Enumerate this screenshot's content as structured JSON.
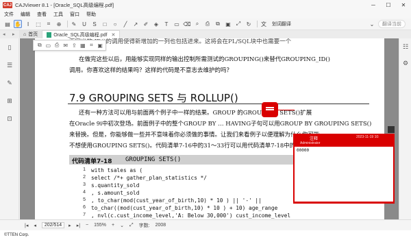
{
  "window": {
    "app_logo": "CAJ",
    "title": "CAJViewer 8.1 - [Oracle_SQL高级编程.pdf]",
    "minimize": "─",
    "maximize": "☐",
    "close": "✕"
  },
  "menu": [
    "文件",
    "编辑",
    "查看",
    "工具",
    "窗口",
    "帮助"
  ],
  "toolbar": {
    "translate_label": "划词翻译",
    "translate_current": "翻译当前"
  },
  "tabs": {
    "home": "首页",
    "doc": "Oracle_SQL高级编程.pdf",
    "doc_close": "✕"
  },
  "page": {
    "line1": "面定义的 ID()的调用使得新增加的一列也包括进来。这将会在PL/SQL块中也需要一个",
    "line2": "在做完这些以后，用能够实现同样的输出控制所需测试的GROUPING()来替代GROUPING_ID()",
    "line3": "调用。你喜欢这样的结果吗？这样的代码是不意志去维护的吗？",
    "heading": "7.9  GROUPING SETS 与 ROLLUP()",
    "para1": "还有一种方法可以用与前面两个例子中一样的结果。GROUP  的GROUPING SETS()扩展",
    "para2": "在Oracle 9i中初次登场。前面例子中的整个GROUP BY … HAVING子句可以用GROUP BY GROUPING SETS()",
    "para3": "来替换。但是，你能够做一些并不意味着你必须做的事情。让我们来看例子以便理解为什么你可能",
    "para4": "不想使用GROUPING SETS()。代码清单7-16中的31～33行可以用代码清单7-18中的",
    "listing_label": "代码清单7-18",
    "listing_title": "GROUPING SETS()",
    "code": [
      {
        "num": "1",
        "text": "with tsales as ("
      },
      {
        "num": "2",
        "text": "select /*+ gather_plan_statistics */"
      },
      {
        "num": "3",
        "text": "   s.quantity_sold"
      },
      {
        "num": "4",
        "text": "   , s.amount_sold"
      },
      {
        "num": "5",
        "text": "   , to_char(mod(cust_year_of_birth,10) * 10 ) || '-' ||"
      },
      {
        "num": "6",
        "text": "     to_char((mod(cust_year_of_birth,10) * 10 ) + 10) age_range"
      },
      {
        "num": "7",
        "text": "   , nvl(c.cust_income_level,'A: Below 30,000') cust_income_level"
      }
    ]
  },
  "note": {
    "title": "注释",
    "date": "2023-11-19 10:",
    "author": "Administrator",
    "text": "00000",
    "close": "✕"
  },
  "status": {
    "page_input": "202/514",
    "zoom": "155%",
    "word_count_label": "字数:",
    "word_count": "2008"
  },
  "footer": "©TTEN Corp."
}
